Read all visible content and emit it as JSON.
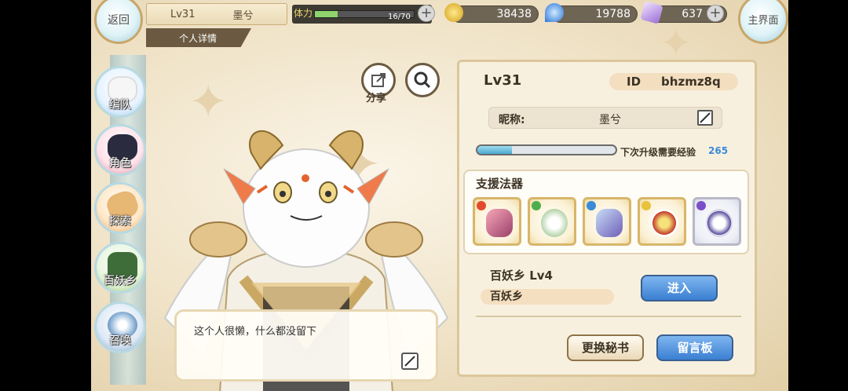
{
  "topbar": {
    "back_label": "返回",
    "home_label": "主界面",
    "player_level": "Lv31",
    "player_name": "墨兮",
    "detail_tab": "个人详情",
    "stamina_label": "体力",
    "stamina_value": "16/70",
    "stamina_fraction": 0.23,
    "gold": "38438",
    "gem": "19788",
    "crystal": "637"
  },
  "nav": {
    "items": [
      {
        "label": "编队"
      },
      {
        "label": "角色"
      },
      {
        "label": "探索"
      },
      {
        "label": "百妖乡"
      },
      {
        "label": "召唤"
      }
    ]
  },
  "actions": {
    "share_label": "分享"
  },
  "bio": {
    "text": "这个人很懒，什么都没留下"
  },
  "profile": {
    "level": "Lv31",
    "id_label": "ID",
    "id_value": "bhzmz8q",
    "nickname_label": "昵称:",
    "nickname_value": "墨兮",
    "exp_label": "下次升级需要经验",
    "exp_value": "265",
    "exp_fraction": 0.25,
    "support_title": "支援法器",
    "village_title": "百妖乡  Lv4",
    "village_name": "百妖乡",
    "enter_label": "进入",
    "swap_secretary_label": "更换秘书",
    "message_board_label": "留言板"
  },
  "colors": {
    "accent_blue": "#3a7fd2",
    "exp_number": "#3a8bd8",
    "stamina_green": "#8ed36b"
  }
}
